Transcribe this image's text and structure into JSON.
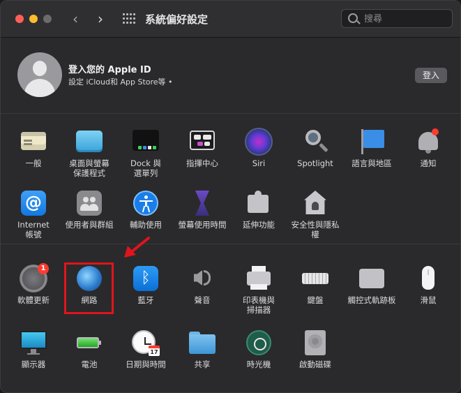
{
  "window": {
    "title": "系統偏好設定",
    "search_placeholder": "搜尋"
  },
  "account": {
    "title": "登入您的 Apple ID",
    "subtitle": "設定 iCloud和 App Store等 •",
    "signin_label": "登入"
  },
  "section1": {
    "panes": [
      {
        "label": "一般",
        "icon": "general-icon"
      },
      {
        "label": "桌面與螢幕\n保護程式",
        "icon": "desktop-screensaver-icon"
      },
      {
        "label": "Dock 與\n選單列",
        "icon": "dock-menubar-icon"
      },
      {
        "label": "指揮中心",
        "icon": "mission-control-icon"
      },
      {
        "label": "Siri",
        "icon": "siri-icon"
      },
      {
        "label": "Spotlight",
        "icon": "spotlight-icon"
      },
      {
        "label": "語言與地區",
        "icon": "language-region-icon"
      },
      {
        "label": "通知",
        "icon": "notifications-icon"
      },
      {
        "label": "Internet\n帳號",
        "icon": "internet-accounts-icon"
      },
      {
        "label": "使用者與群組",
        "icon": "users-groups-icon"
      },
      {
        "label": "輔助使用",
        "icon": "accessibility-icon"
      },
      {
        "label": "螢幕使用時間",
        "icon": "screen-time-icon"
      },
      {
        "label": "延伸功能",
        "icon": "extensions-icon"
      },
      {
        "label": "安全性與隱私權",
        "icon": "security-privacy-icon"
      }
    ]
  },
  "section2": {
    "panes": [
      {
        "label": "軟體更新",
        "icon": "software-update-icon",
        "badge": "1"
      },
      {
        "label": "網路",
        "icon": "network-icon"
      },
      {
        "label": "藍牙",
        "icon": "bluetooth-icon"
      },
      {
        "label": "聲音",
        "icon": "sound-icon"
      },
      {
        "label": "印表機與\n掃描器",
        "icon": "printers-scanners-icon"
      },
      {
        "label": "鍵盤",
        "icon": "keyboard-icon"
      },
      {
        "label": "觸控式軌跡板",
        "icon": "trackpad-icon"
      },
      {
        "label": "滑鼠",
        "icon": "mouse-icon"
      },
      {
        "label": "顯示器",
        "icon": "displays-icon"
      },
      {
        "label": "電池",
        "icon": "battery-icon"
      },
      {
        "label": "日期與時間",
        "icon": "date-time-icon",
        "calendar_day": "17"
      },
      {
        "label": "共享",
        "icon": "sharing-icon"
      },
      {
        "label": "時光機",
        "icon": "time-machine-icon"
      },
      {
        "label": "啟動磁碟",
        "icon": "startup-disk-icon"
      }
    ]
  },
  "colors": {
    "annotation": "#e0141c",
    "background": "#2a2a2c"
  }
}
